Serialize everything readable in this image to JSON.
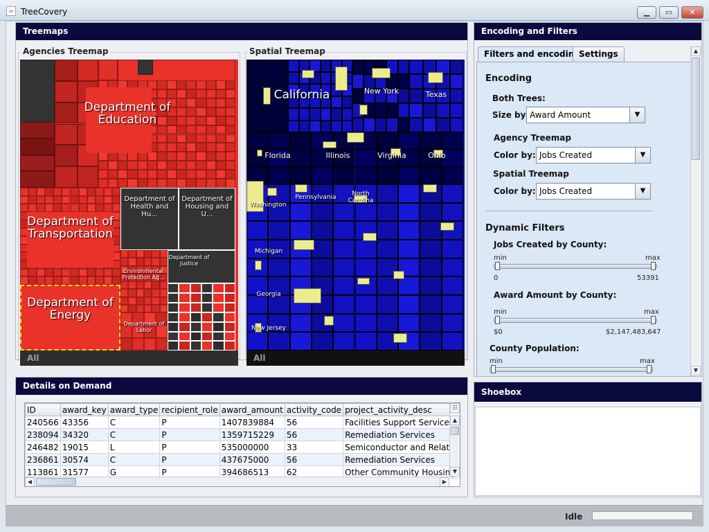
{
  "window": {
    "title": "TreeCovery",
    "minimize_icon": "minimize-icon",
    "maximize_icon": "maximize-icon",
    "close_icon": "close-icon"
  },
  "treemaps_panel": {
    "header": "Treemaps",
    "agencies": {
      "title": "Agencies Treemap",
      "footer": "All",
      "labels": [
        "Department of Education",
        "Department of Transportation",
        "Department of Health and Hu...",
        "Department of Housing and U...",
        "Department of Justice",
        "Environmental Protection Ag...",
        "Department of Energy",
        "Department of Labor"
      ]
    },
    "spatial": {
      "title": "Spatial Treemap",
      "footer": "All",
      "labels": [
        "California",
        "New York",
        "Texas",
        "Florida",
        "Illinois",
        "Virginia",
        "Ohio",
        "Washington",
        "Pennsylvania",
        "North Carolina",
        "Michigan",
        "Georgia",
        "New Jersey"
      ]
    }
  },
  "encoding_panel": {
    "header": "Encoding and Filters",
    "tabs": [
      "Filters and encoding",
      "Settings"
    ],
    "encoding_title": "Encoding",
    "both_trees": "Both Trees:",
    "size_by_label": "Size by:",
    "size_by_value": "Award Amount",
    "agency_treemap": "Agency Treemap",
    "agency_color_label": "Color by:",
    "agency_color_value": "Jobs Created",
    "spatial_treemap": "Spatial Treemap",
    "spatial_color_label": "Color by:",
    "spatial_color_value": "Jobs Created",
    "dynamic_filters": "Dynamic Filters",
    "filters": [
      {
        "label": "Jobs Created by County:",
        "min_label": "min",
        "max_label": "max",
        "min": "0",
        "max": "53391"
      },
      {
        "label": "Award Amount by County:",
        "min_label": "min",
        "max_label": "max",
        "min": "$0",
        "max": "$2,147,483,647"
      },
      {
        "label": "County Population:",
        "min_label": "min",
        "max_label": "max"
      }
    ]
  },
  "details_panel": {
    "header": "Details on Demand",
    "columns": [
      "ID",
      "award_key",
      "award_type",
      "recipient_role",
      "award_amount",
      "activity_code",
      "project_activity_desc"
    ],
    "rows": [
      [
        "240566",
        "43356",
        "C",
        "P",
        "1407839884",
        "56",
        "Facilities Support Services"
      ],
      [
        "238094",
        "34320",
        "C",
        "P",
        "1359715229",
        "56",
        "Remediation Services"
      ],
      [
        "246482",
        "19015",
        "L",
        "P",
        "535000000",
        "33",
        "Semiconductor and Related D..."
      ],
      [
        "236861",
        "30574",
        "C",
        "P",
        "437675000",
        "56",
        "Remediation Services"
      ],
      [
        "113861",
        "31577",
        "G",
        "P",
        "394686513",
        "62",
        "Other Community Housing Ser..."
      ]
    ]
  },
  "shoebox_panel": {
    "header": "Shoebox"
  },
  "status": {
    "text": "Idle"
  },
  "colors": {
    "header_bg": "#0a0a3e",
    "agency_red": "#e8322a",
    "agency_dark": "#333333",
    "spatial_blue": "#1111cc",
    "spatial_yellow": "#ecec8c"
  }
}
